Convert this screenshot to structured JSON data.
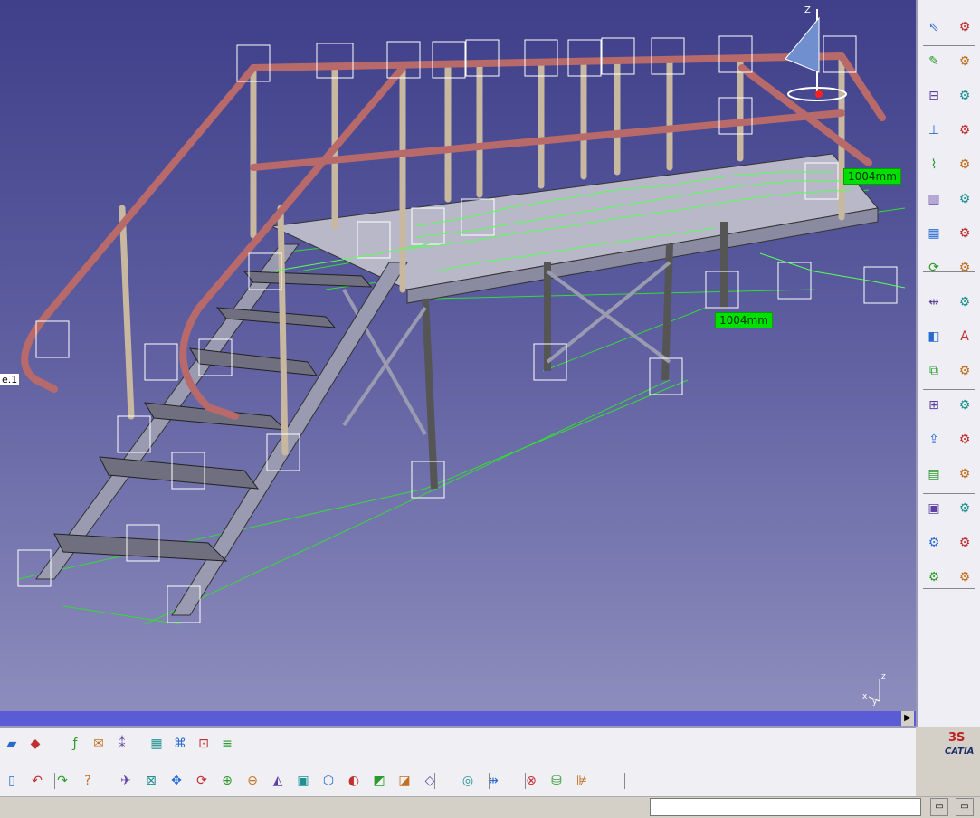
{
  "viewport": {
    "dimension_badges": [
      "1004mm",
      "1004mm"
    ],
    "part_label": "e.1",
    "compass_axis_z": "Z",
    "triad_axes": {
      "x": "x",
      "y": "y",
      "z": "z"
    }
  },
  "icons": {
    "right_toolbar": [
      "select-arrow-icon",
      "gear-icon",
      "sketch-icon",
      "gear-icon",
      "stairs-icon",
      "gear-icon",
      "rail-icon",
      "gear-icon",
      "pipe-icon",
      "gear-icon",
      "profile-icon",
      "gear-icon",
      "plate-icon",
      "gear-icon",
      "rotate-icon",
      "gear-icon",
      "measure-icon",
      "gear-icon",
      "body-icon",
      "text-icon",
      "assembly-icon",
      "gear-icon",
      "tree-icon",
      "gear-icon",
      "publish-icon",
      "gear-icon",
      "catalog-icon",
      "gear-icon",
      "doc-icon",
      "gear-icon",
      "gear-icon",
      "gear-icon",
      "gear-icon",
      "gear-icon"
    ],
    "bottom_row1": [
      "folder-icon",
      "multicolor-icon",
      "formula-icon",
      "comment-icon",
      "knowledge-icon",
      "table-icon",
      "graph-icon",
      "lock-icon",
      "parameter-icon"
    ],
    "bottom_row2": [
      "new-icon",
      "undo-icon",
      "redo-icon",
      "whats-this-icon",
      "fly-icon",
      "fit-all-icon",
      "pan-icon",
      "rotate-icon",
      "zoom-in-icon",
      "zoom-out-icon",
      "normal-view-icon",
      "multi-view-icon",
      "iso-view-icon",
      "hide-show-icon",
      "render-icon",
      "render2-icon",
      "cube-icon",
      "spin-icon",
      "measure-icon",
      "inertia-icon",
      "database-icon",
      "analysis-icon"
    ]
  },
  "status": {
    "command_value": "",
    "logo_text": "CATIA"
  }
}
